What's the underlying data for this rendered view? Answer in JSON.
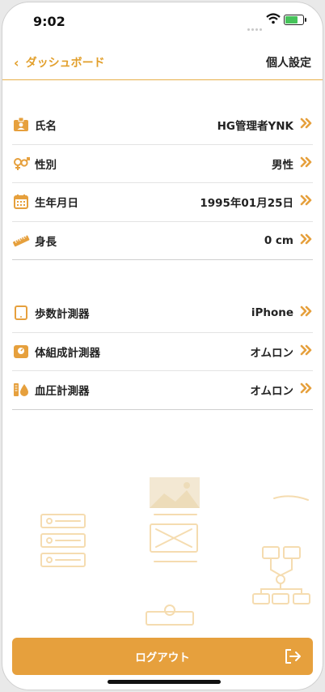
{
  "status": {
    "time": "9:02"
  },
  "nav": {
    "back_label": "ダッシュボード",
    "title": "個人設定"
  },
  "profile": [
    {
      "icon": "id-badge-icon",
      "label": "氏名",
      "value": "HG管理者YNK"
    },
    {
      "icon": "gender-icon",
      "label": "性別",
      "value": "男性"
    },
    {
      "icon": "calendar-icon",
      "label": "生年月日",
      "value": "1995年01月25日"
    },
    {
      "icon": "ruler-icon",
      "label": "身長",
      "value": "0 cm"
    }
  ],
  "devices": [
    {
      "icon": "tablet-icon",
      "label": "歩数計測器",
      "value": "iPhone"
    },
    {
      "icon": "scale-icon",
      "label": "体組成計測器",
      "value": "オムロン"
    },
    {
      "icon": "blood-pressure-icon",
      "label": "血圧計測器",
      "value": "オムロン"
    }
  ],
  "logout": {
    "label": "ログアウト"
  },
  "colors": {
    "accent": "#e6a03d",
    "nav_text": "#e29f2b"
  }
}
